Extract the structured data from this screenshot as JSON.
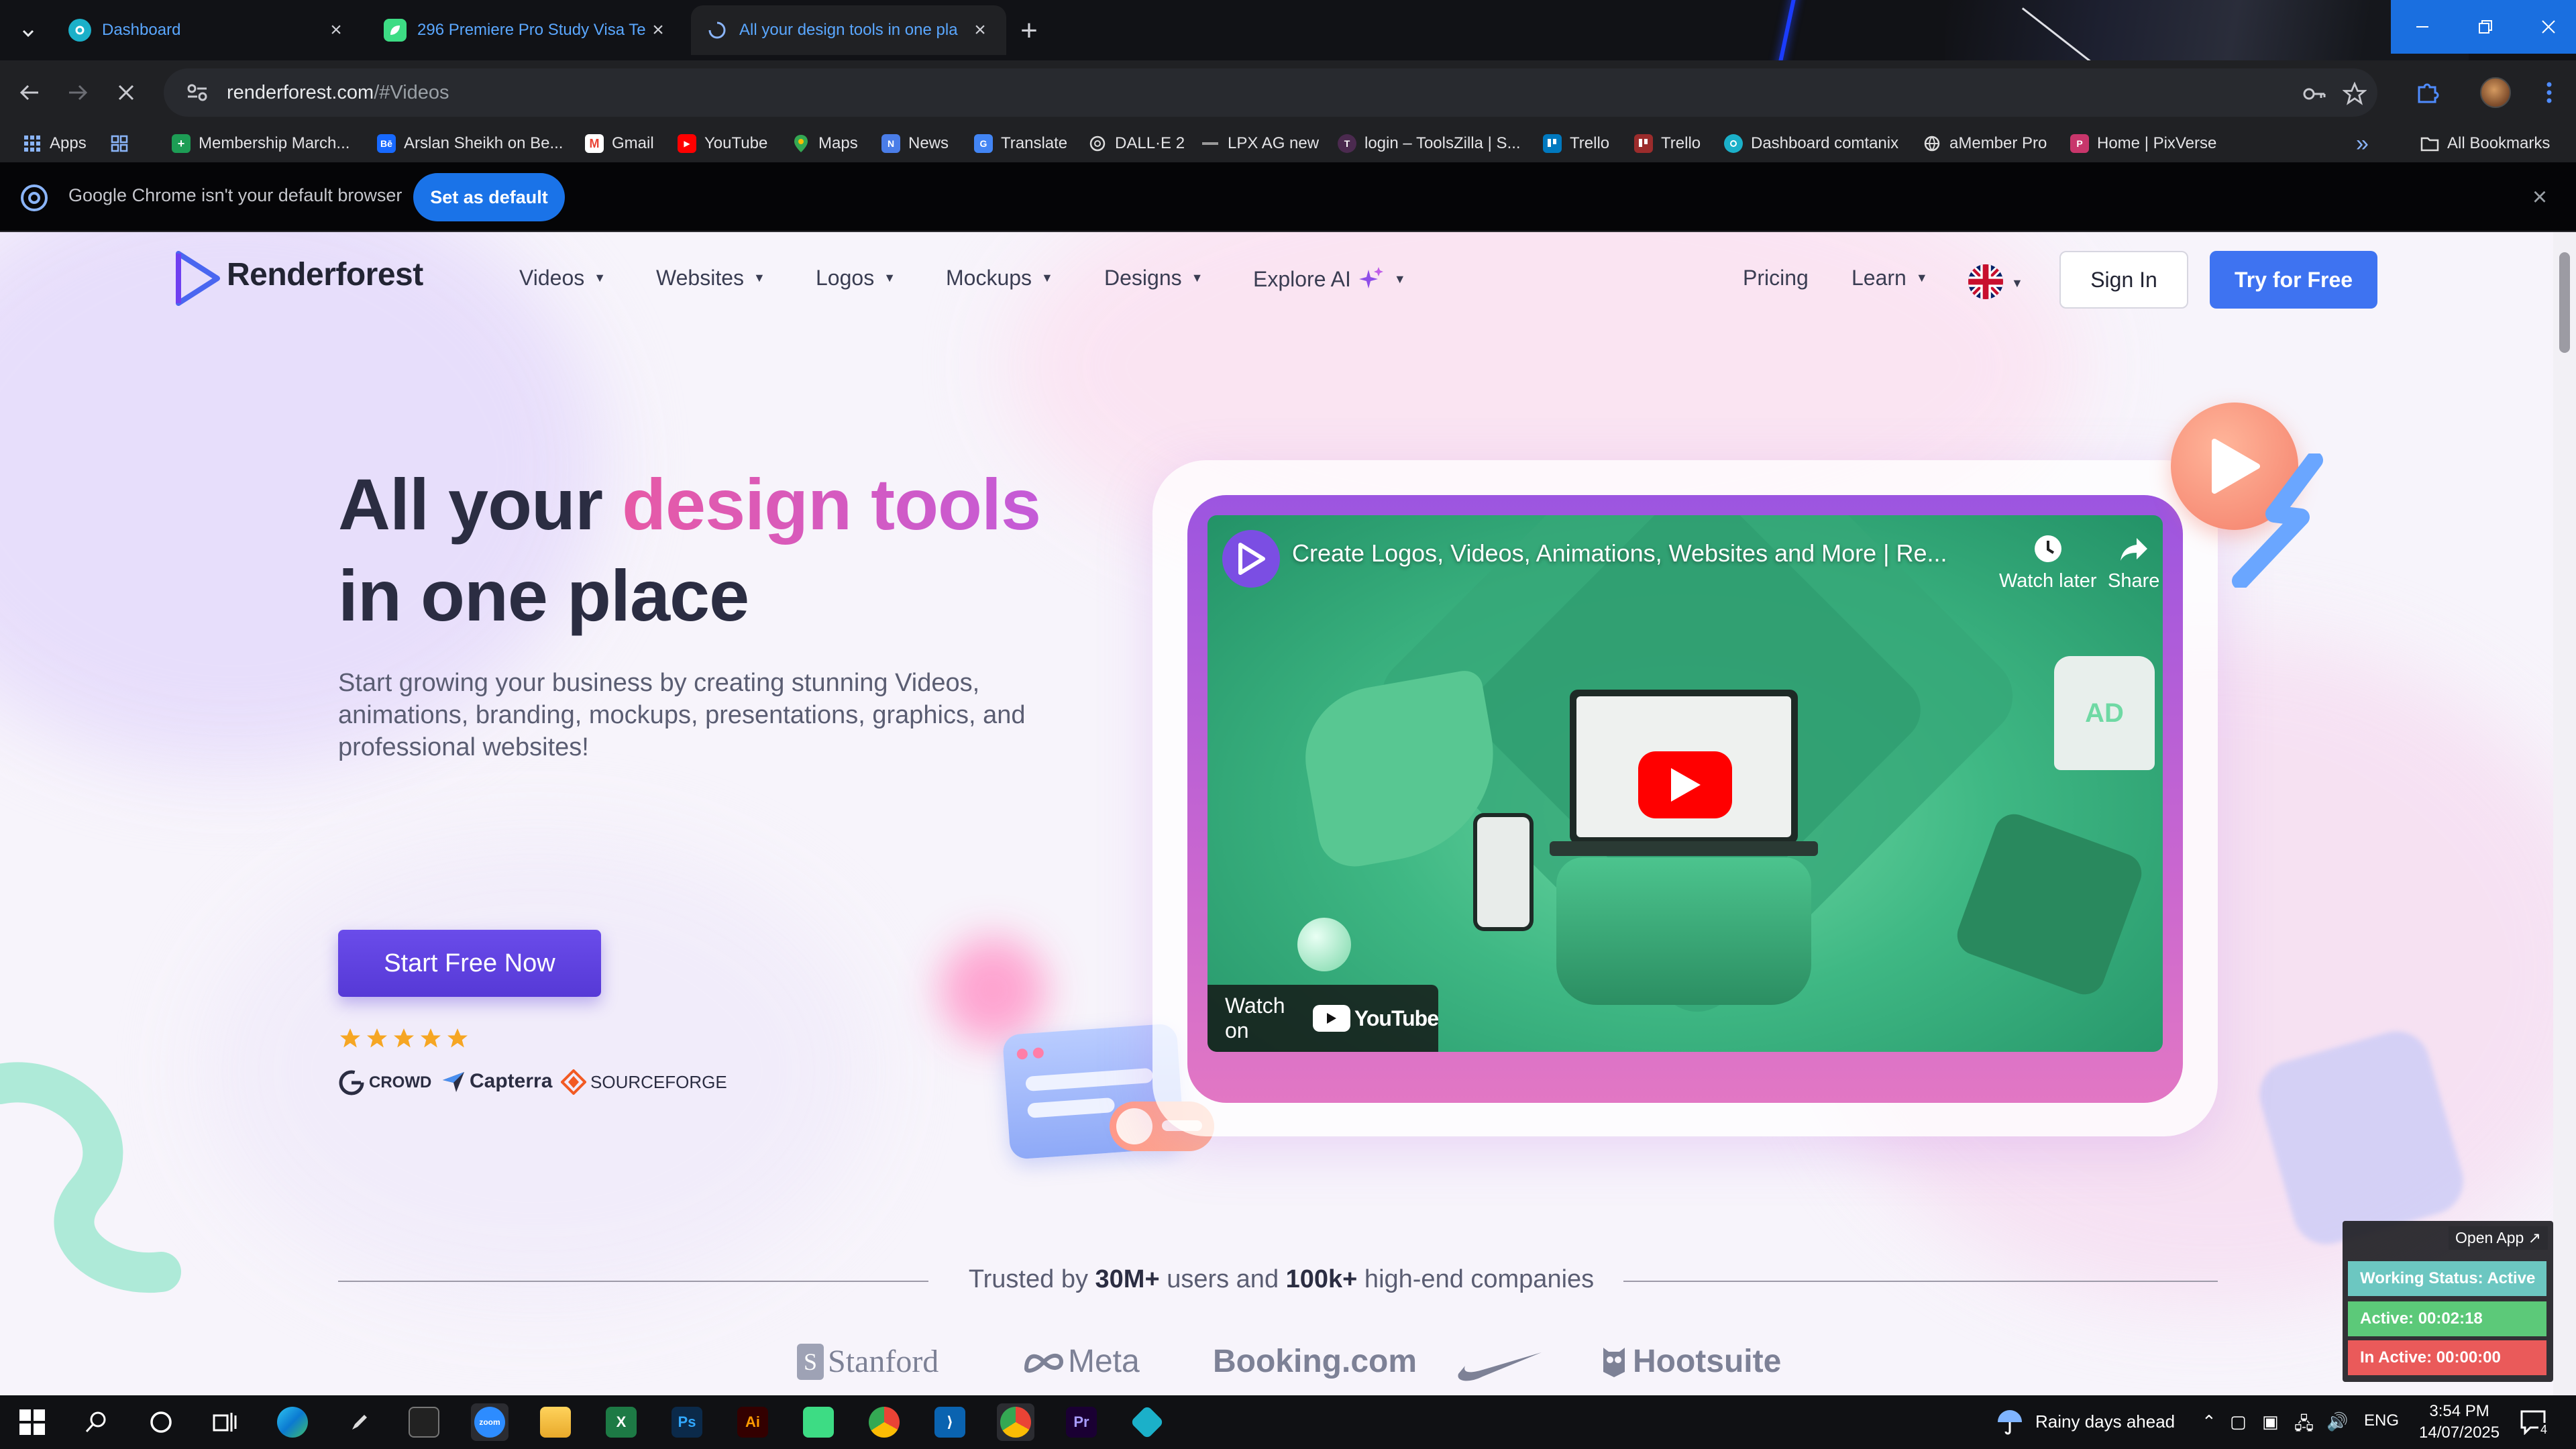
{
  "tabs": [
    {
      "title": "Dashboard",
      "icon": "gear-app-icon",
      "color": "#1bb0c9"
    },
    {
      "title": "296 Premiere Pro Study Visa Te",
      "icon": "leaf-app-icon",
      "color": "#3ddc84"
    },
    {
      "title": "All your design tools in one pla",
      "icon": "loading-icon",
      "color": "#888"
    }
  ],
  "address": {
    "domain": "renderforest.com",
    "path": "/#Videos"
  },
  "bookmarks": [
    {
      "label": "Apps"
    },
    {
      "label": "Membership March..."
    },
    {
      "label": "Arslan Sheikh on Be..."
    },
    {
      "label": "Gmail"
    },
    {
      "label": "YouTube"
    },
    {
      "label": "Maps"
    },
    {
      "label": "News"
    },
    {
      "label": "Translate"
    },
    {
      "label": "DALL·E 2"
    },
    {
      "label": "LPX AG new"
    },
    {
      "label": "login – ToolsZilla | S..."
    },
    {
      "label": "Trello"
    },
    {
      "label": "Trello"
    },
    {
      "label": "Dashboard comtanix"
    },
    {
      "label": "aMember Pro"
    },
    {
      "label": "Home | PixVerse"
    }
  ],
  "all_bookmarks": "All Bookmarks",
  "default_bar": {
    "message": "Google Chrome isn't your default browser",
    "button": "Set as default"
  },
  "site": {
    "brand": "Renderforest",
    "nav": [
      "Videos",
      "Websites",
      "Logos",
      "Mockups",
      "Designs",
      "Explore AI"
    ],
    "pricing": "Pricing",
    "learn": "Learn",
    "sign_in": "Sign In",
    "try_free": "Try for Free",
    "hero_line1_a": "All your ",
    "hero_line1_b": "design tools",
    "hero_line2": "in one place",
    "subtitle": "Start growing your business by creating stunning Videos, animations, branding, mockups, presentations, graphics, and professional websites!",
    "cta": "Start Free Now",
    "rating_stars": 5,
    "reviews": [
      "CROWD",
      "Capterra",
      "SOURCEFORGE"
    ],
    "trusted_pre": "Trusted by ",
    "trusted_users": "30M+",
    "trusted_mid": " users and ",
    "trusted_companies": "100k+",
    "trusted_post": " high-end companies",
    "brands": [
      "Stanford",
      "Meta",
      "Booking.com",
      "Hootsuite"
    ]
  },
  "video": {
    "title": "Create Logos, Videos, Animations, Websites and More | Re...",
    "watch_later": "Watch later",
    "share": "Share",
    "watch_on": "Watch on",
    "youtube": "YouTube"
  },
  "tracker": {
    "open_app": "Open App ↗",
    "status": "Working Status: Active",
    "active": "Active: 00:02:18",
    "inactive": "In Active: 00:00:00"
  },
  "taskbar": {
    "weather": "Rainy days ahead",
    "lang": "ENG",
    "time": "3:54 PM",
    "date": "14/07/2025",
    "notifications": "4"
  },
  "colors": {
    "accent": "#3e73f1",
    "cta": "#5639d6",
    "chrome_blue": "#1a73e8"
  }
}
